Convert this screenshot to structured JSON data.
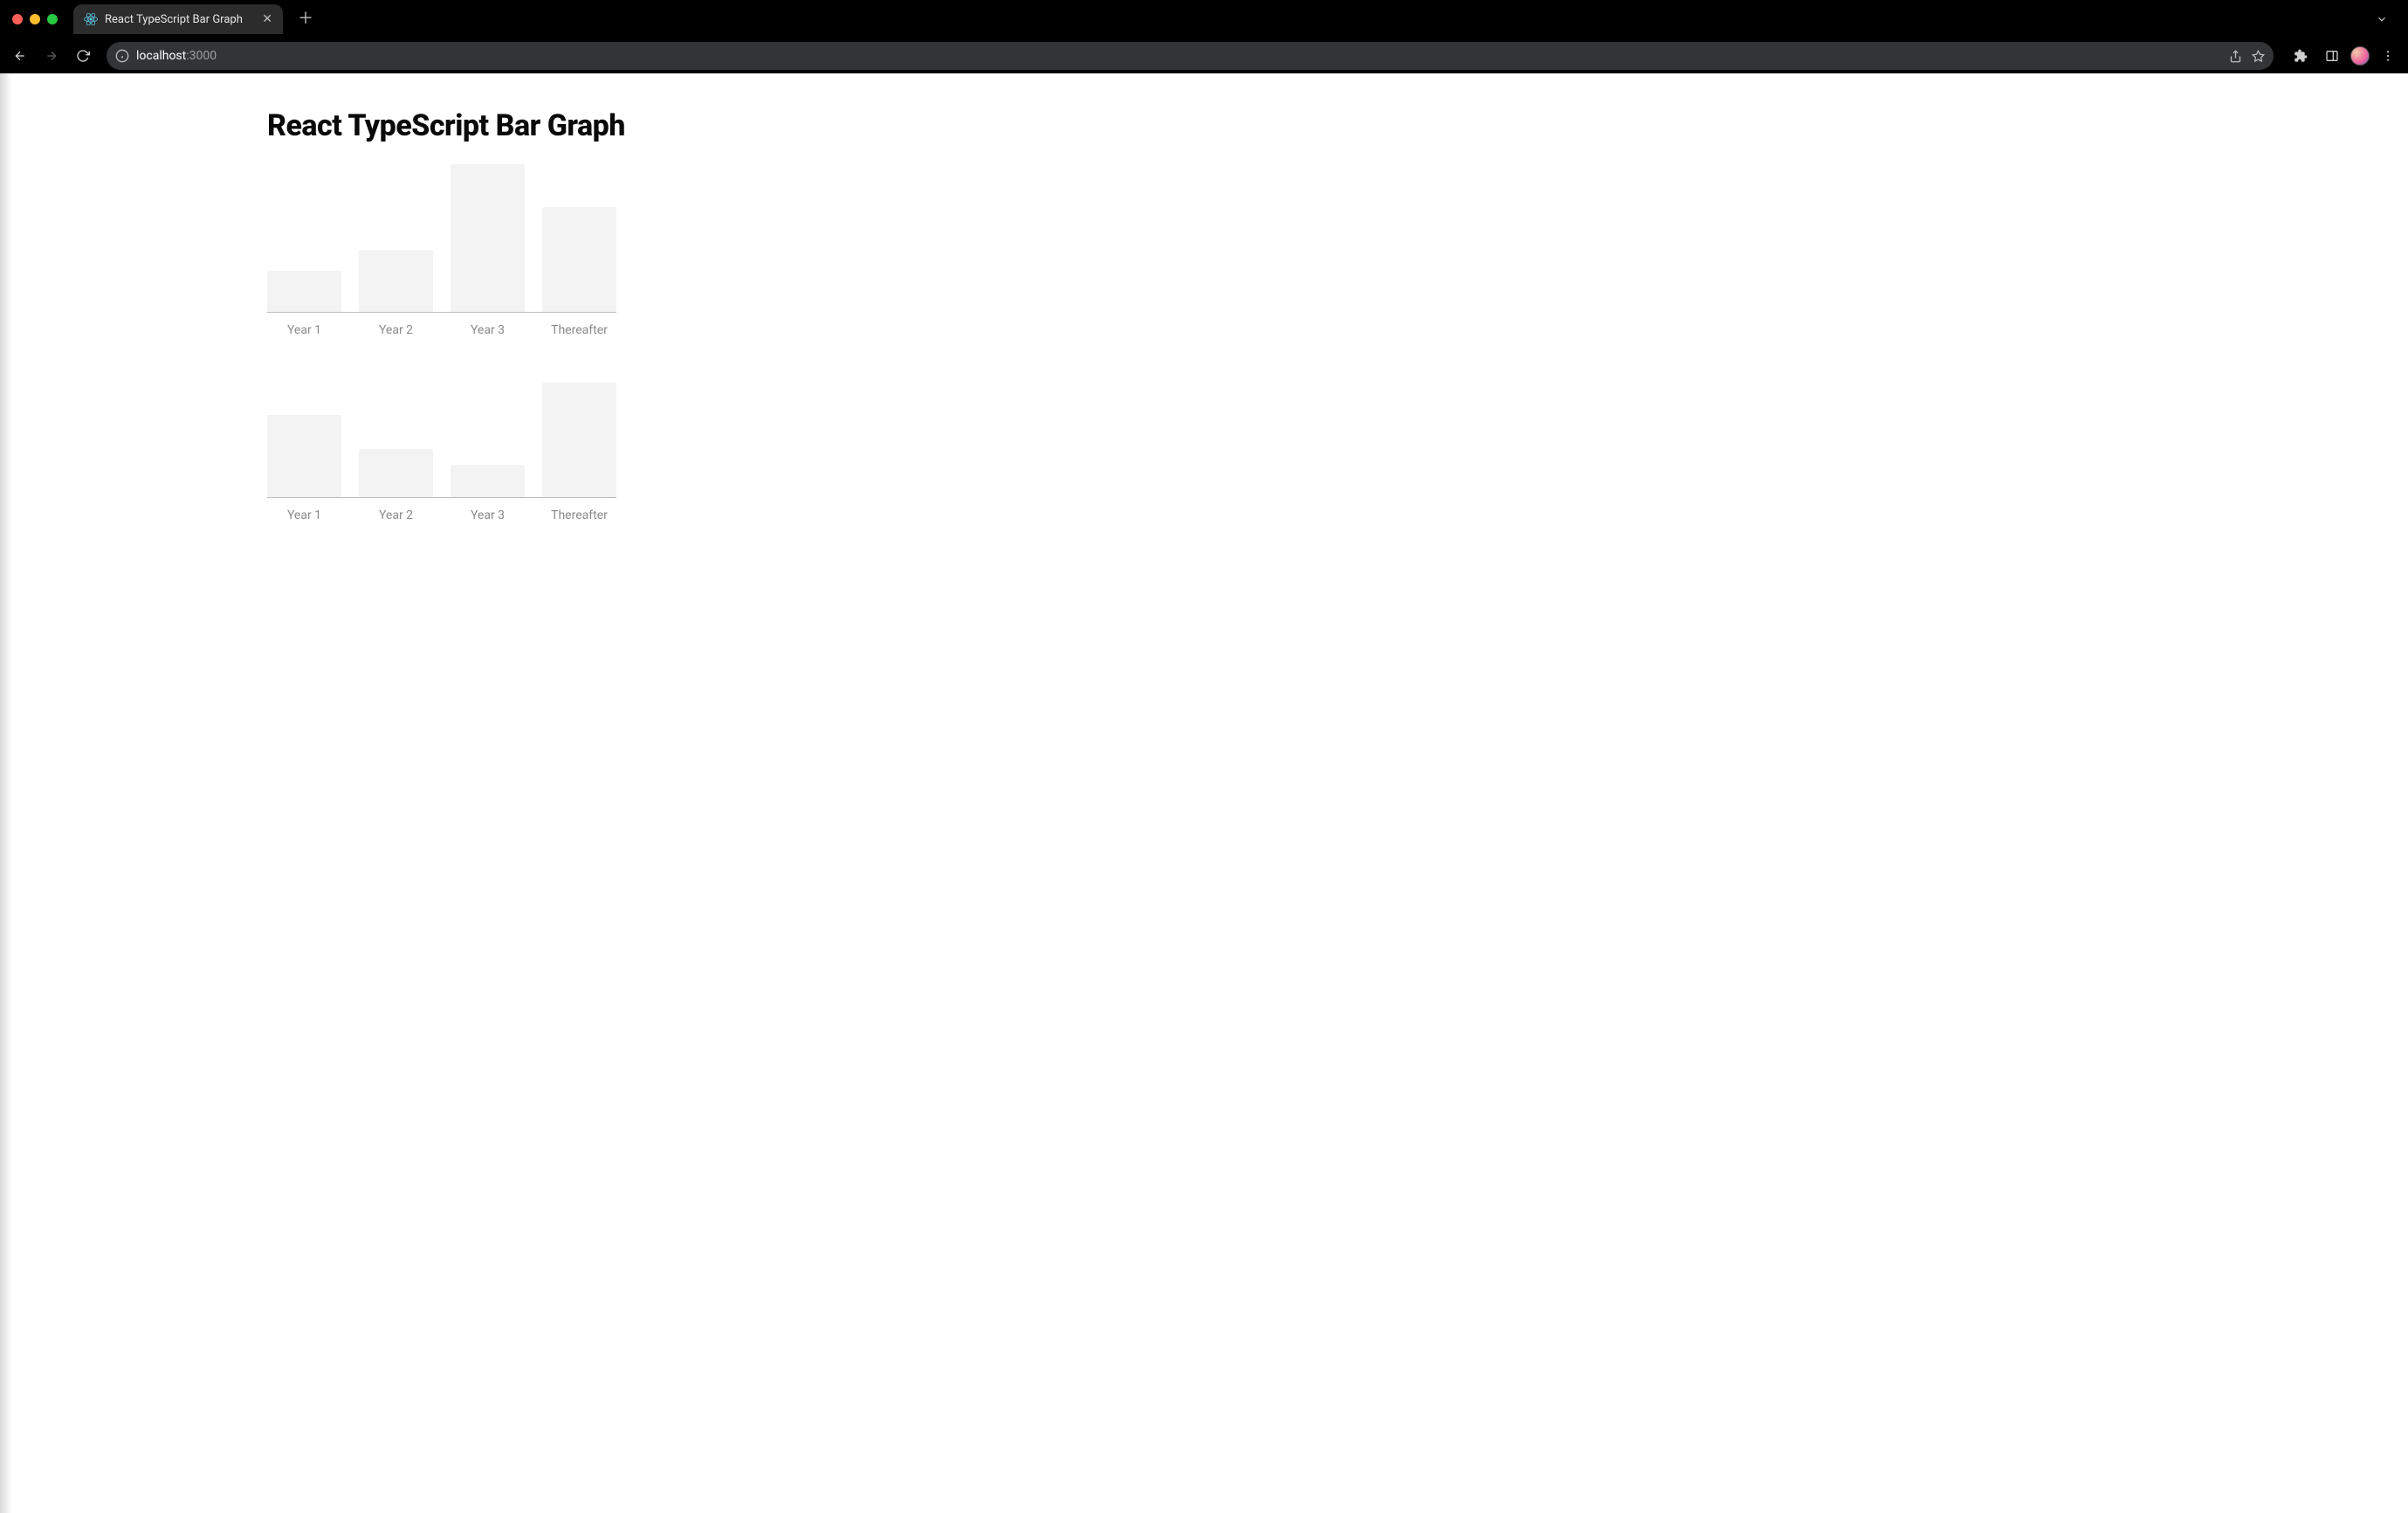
{
  "browser": {
    "tab_title": "React TypeScript Bar Graph",
    "url_host": "localhost",
    "url_port": ":3000"
  },
  "page": {
    "heading": "React TypeScript Bar Graph"
  },
  "chart_data": [
    {
      "type": "bar",
      "categories": [
        "Year 1",
        "Year 2",
        "Year 3",
        "Thereafter"
      ],
      "values": [
        28,
        42,
        100,
        71
      ],
      "title": "",
      "xlabel": "",
      "ylabel": "",
      "ylim": [
        0,
        100
      ],
      "bar_color": "#f3f3f3",
      "axis_color": "#bdbdbd"
    },
    {
      "type": "bar",
      "categories": [
        "Year 1",
        "Year 2",
        "Year 3",
        "Thereafter"
      ],
      "values": [
        72,
        42,
        28,
        100
      ],
      "title": "",
      "xlabel": "",
      "ylabel": "",
      "ylim": [
        0,
        100
      ],
      "bar_color": "#f3f3f3",
      "axis_color": "#bdbdbd"
    }
  ]
}
